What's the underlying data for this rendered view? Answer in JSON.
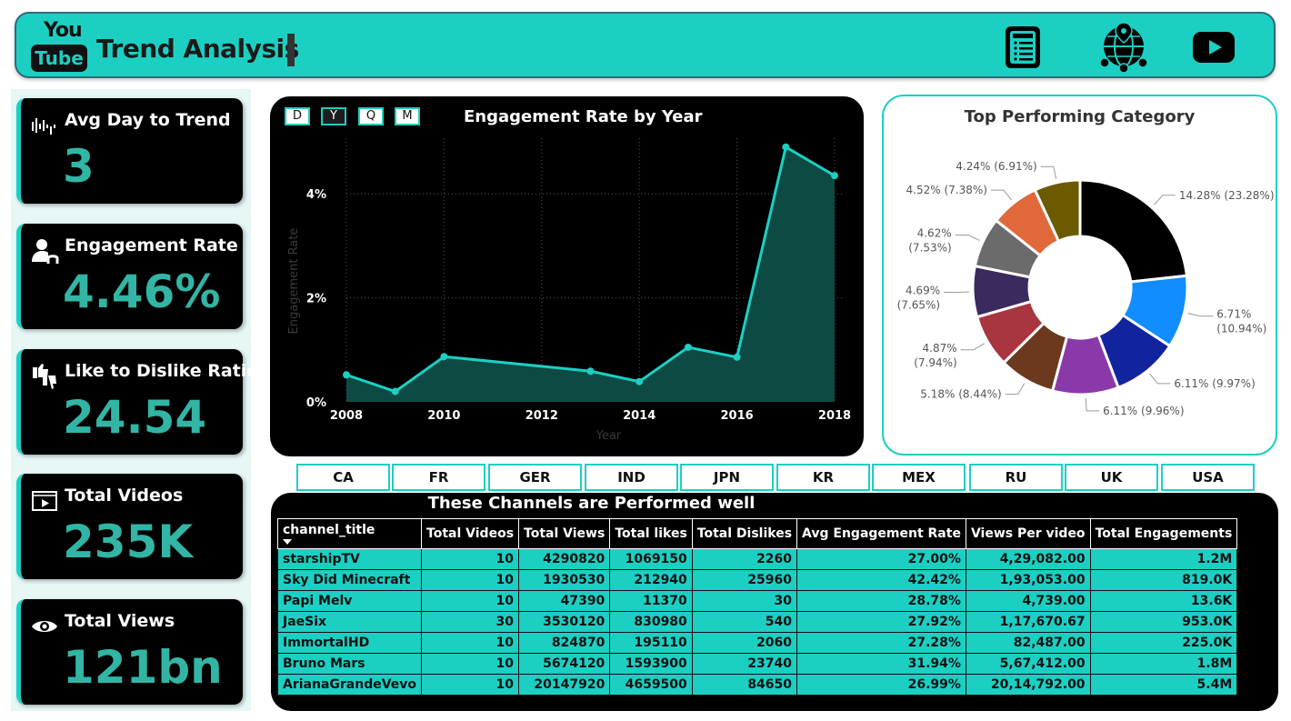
{
  "header": {
    "logo_top": "You",
    "logo_bottom": "Tube",
    "title": "Trend Analysis",
    "icons": [
      "document-icon",
      "globe-network-icon",
      "youtube-play-icon"
    ]
  },
  "kpis": [
    {
      "label": "Avg Day to Trend",
      "value": "3",
      "icon": "sound-wave-icon"
    },
    {
      "label": "Engagement Rate",
      "value": "4.46%",
      "icon": "user-engagement-icon"
    },
    {
      "label": "Like to Dislike Ratio",
      "value": "24.54",
      "icon": "thumbs-icon"
    },
    {
      "label": "Total Videos",
      "value": "235K",
      "icon": "video-icon"
    },
    {
      "label": "Total Views",
      "value": "121bn",
      "icon": "eye-icon"
    }
  ],
  "granularity": {
    "options": [
      "D",
      "Y",
      "Q",
      "M"
    ],
    "selected": "Y"
  },
  "colors": {
    "accent": "#1ccfc3",
    "kpi_value": "#32b5a5",
    "area_fill": "#0e4a44"
  },
  "chart_data": [
    {
      "type": "area",
      "title": "Engagement Rate by Year",
      "xlabel": "Year",
      "ylabel": "Engagement Rate",
      "x": [
        2008,
        2009,
        2010,
        2013,
        2014,
        2015,
        2016,
        2017,
        2018
      ],
      "values": [
        0.52,
        0.2,
        0.87,
        0.59,
        0.39,
        1.05,
        0.86,
        4.9,
        4.35
      ],
      "xticks": [
        "2008",
        "2010",
        "2012",
        "2014",
        "2016",
        "2018"
      ],
      "yticks": [
        "0%",
        "2%",
        "4%"
      ],
      "ylim": [
        0,
        5
      ],
      "xlim": [
        2008,
        2018
      ],
      "grid": true
    },
    {
      "type": "pie",
      "title": "Top Performing Category",
      "slices": [
        {
          "value": 23.28,
          "label": "14.28% (23.28%)",
          "color": "#000000"
        },
        {
          "value": 10.94,
          "label": "6.71% (10.94%)",
          "color": "#118dff"
        },
        {
          "value": 9.97,
          "label": "6.11% (9.97%)",
          "color": "#12239e"
        },
        {
          "value": 9.96,
          "label": "6.11% (9.96%)",
          "color": "#8a3aa8"
        },
        {
          "value": 8.44,
          "label": "5.18% (8.44%)",
          "color": "#6b3a1e"
        },
        {
          "value": 7.94,
          "label": "4.87% (7.94%)",
          "color": "#a83540"
        },
        {
          "value": 7.65,
          "label": "4.69% (7.65%)",
          "color": "#3a2a5e"
        },
        {
          "value": 7.53,
          "label": "4.62% (7.53%)",
          "color": "#6b6b6b"
        },
        {
          "value": 7.38,
          "label": "4.52% (7.38%)",
          "color": "#e0683a"
        },
        {
          "value": 6.91,
          "label": "4.24% (6.91%)",
          "color": "#6b5a00"
        }
      ]
    }
  ],
  "countries": [
    "CA",
    "FR",
    "GER",
    "IND",
    "JPN",
    "KR",
    "MEX",
    "RU",
    "UK",
    "USA"
  ],
  "table": {
    "title": "These Channels are Performed well",
    "columns": [
      "channel_title",
      "Total Videos",
      "Total Views",
      "Total likes",
      "Total Dislikes",
      "Avg Engagement Rate",
      "Views Per video",
      "Total Engagements"
    ],
    "rows": [
      [
        "starshipTV",
        "10",
        "4290820",
        "1069150",
        "2260",
        "27.00%",
        "4,29,082.00",
        "1.2M"
      ],
      [
        "Sky Did Minecraft",
        "10",
        "1930530",
        "212940",
        "25960",
        "42.42%",
        "1,93,053.00",
        "819.0K"
      ],
      [
        "Papi Melv",
        "10",
        "47390",
        "11370",
        "30",
        "28.78%",
        "4,739.00",
        "13.6K"
      ],
      [
        "JaeSix",
        "30",
        "3530120",
        "830980",
        "540",
        "27.92%",
        "1,17,670.67",
        "953.0K"
      ],
      [
        "ImmortalHD",
        "10",
        "824870",
        "195110",
        "2060",
        "27.28%",
        "82,487.00",
        "225.0K"
      ],
      [
        "Bruno Mars",
        "10",
        "5674120",
        "1593900",
        "23740",
        "31.94%",
        "5,67,412.00",
        "1.8M"
      ],
      [
        "ArianaGrandeVevo",
        "10",
        "20147920",
        "4659500",
        "84650",
        "26.99%",
        "20,14,792.00",
        "5.4M"
      ]
    ]
  }
}
